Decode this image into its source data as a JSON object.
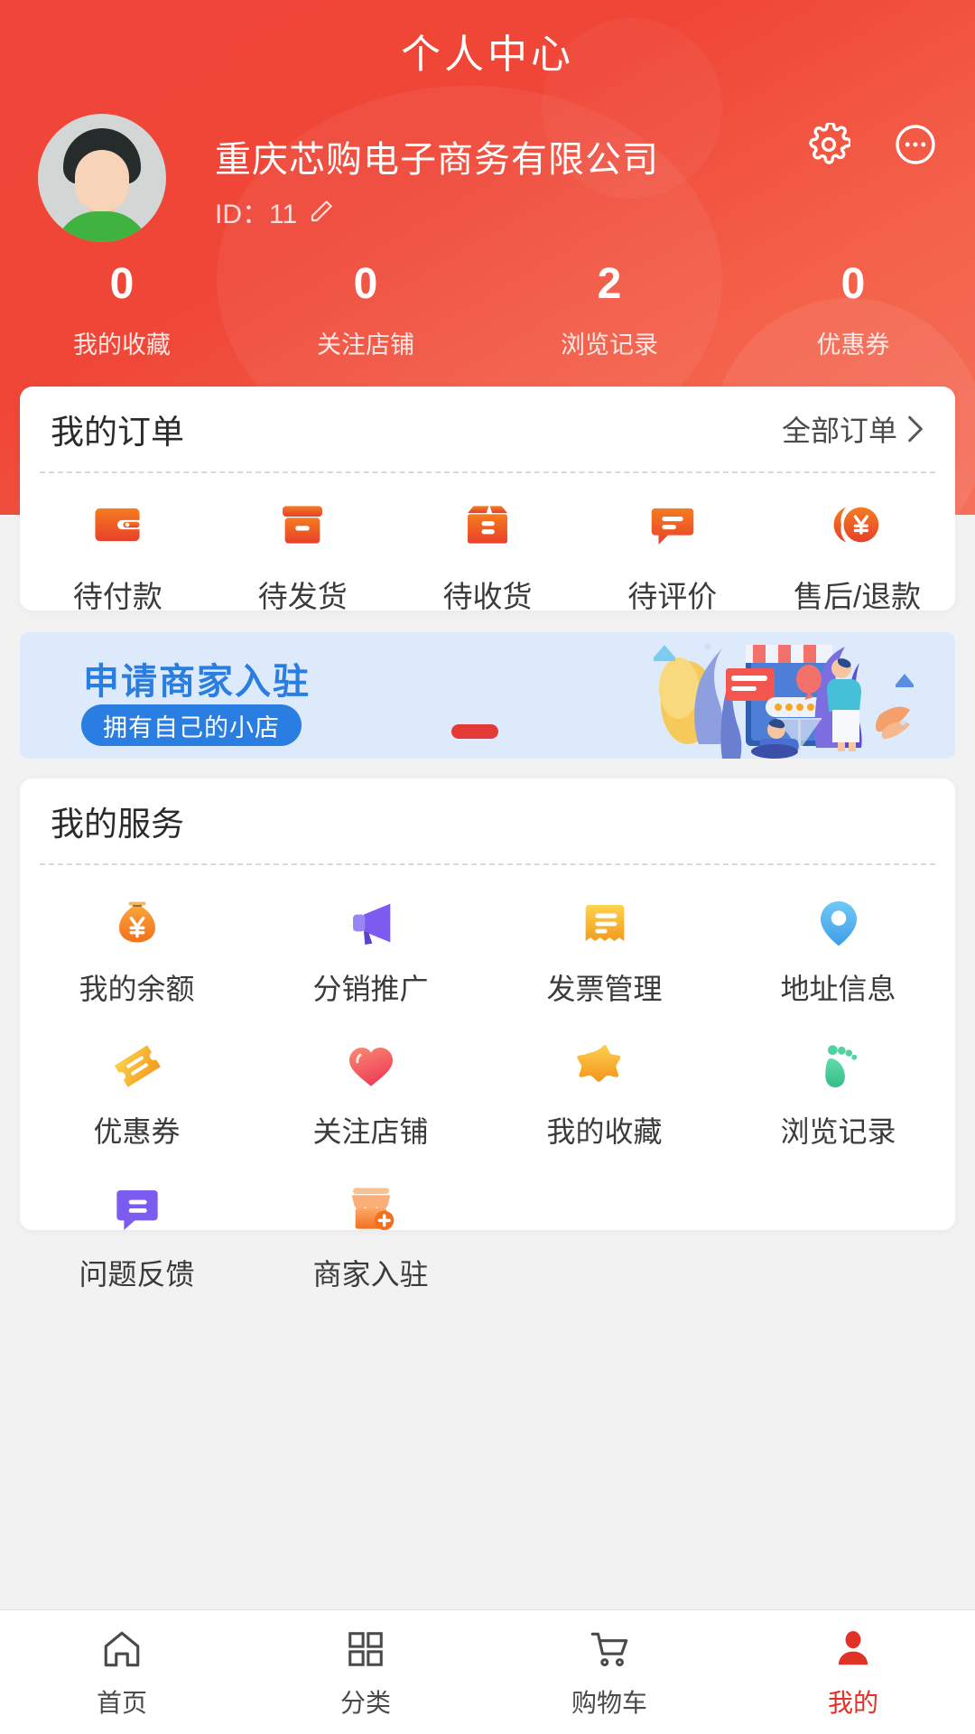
{
  "header": {
    "title": "个人中心",
    "user_name": "重庆芯购电子商务有限公司",
    "user_id_label": "ID：11",
    "edit_icon": "pencil-edit-icon",
    "settings_icon": "gear-icon",
    "more_icon": "more-dots-icon",
    "avatar_icon": "user-avatar"
  },
  "stats": [
    {
      "value": "0",
      "label": "我的收藏"
    },
    {
      "value": "0",
      "label": "关注店铺"
    },
    {
      "value": "2",
      "label": "浏览记录"
    },
    {
      "value": "0",
      "label": "优惠券"
    }
  ],
  "orders": {
    "title": "我的订单",
    "more_label": "全部订单",
    "chevron_icon": "chevron-right-icon",
    "items": [
      {
        "label": "待付款",
        "icon": "wallet-icon"
      },
      {
        "label": "待发货",
        "icon": "box-icon"
      },
      {
        "label": "待收货",
        "icon": "package-icon"
      },
      {
        "label": "待评价",
        "icon": "comment-icon"
      },
      {
        "label": "售后/退款",
        "icon": "refund-yuan-icon"
      }
    ]
  },
  "banner": {
    "title": "申请商家入驻",
    "pill_label": "拥有自己的小店",
    "art_icon": "shop-illustration"
  },
  "services": {
    "title": "我的服务",
    "items": [
      {
        "label": "我的余额",
        "icon": "money-bag-icon",
        "color": "#f58220"
      },
      {
        "label": "分销推广",
        "icon": "megaphone-icon",
        "color": "#7c5cf0"
      },
      {
        "label": "发票管理",
        "icon": "invoice-icon",
        "color": "#fbbc2e"
      },
      {
        "label": "地址信息",
        "icon": "location-pin-icon",
        "color": "#56b9f0"
      },
      {
        "label": "优惠券",
        "icon": "coupon-ticket-icon",
        "color": "#f5b325"
      },
      {
        "label": "关注店铺",
        "icon": "heart-icon",
        "color": "#f2545b"
      },
      {
        "label": "我的收藏",
        "icon": "star-icon",
        "color": "#f9a825"
      },
      {
        "label": "浏览记录",
        "icon": "footprint-icon",
        "color": "#4ecf9a"
      },
      {
        "label": "问题反馈",
        "icon": "feedback-chat-icon",
        "color": "#7c5cf0"
      },
      {
        "label": "商家入驻",
        "icon": "shop-add-icon",
        "color": "#f58220"
      }
    ]
  },
  "tabbar": {
    "items": [
      {
        "label": "首页",
        "icon": "home-icon",
        "active": false
      },
      {
        "label": "分类",
        "icon": "grid-categories-icon",
        "active": false
      },
      {
        "label": "购物车",
        "icon": "shopping-cart-icon",
        "active": false
      },
      {
        "label": "我的",
        "icon": "person-icon",
        "active": true
      }
    ],
    "active_color": "#e03226",
    "inactive_color": "#4a4a4a"
  },
  "colors": {
    "brand_red": "#ef4637",
    "order_icon_orange": "#f4511e",
    "banner_blue": "#2a7de1",
    "banner_bg": "#dceafc"
  }
}
